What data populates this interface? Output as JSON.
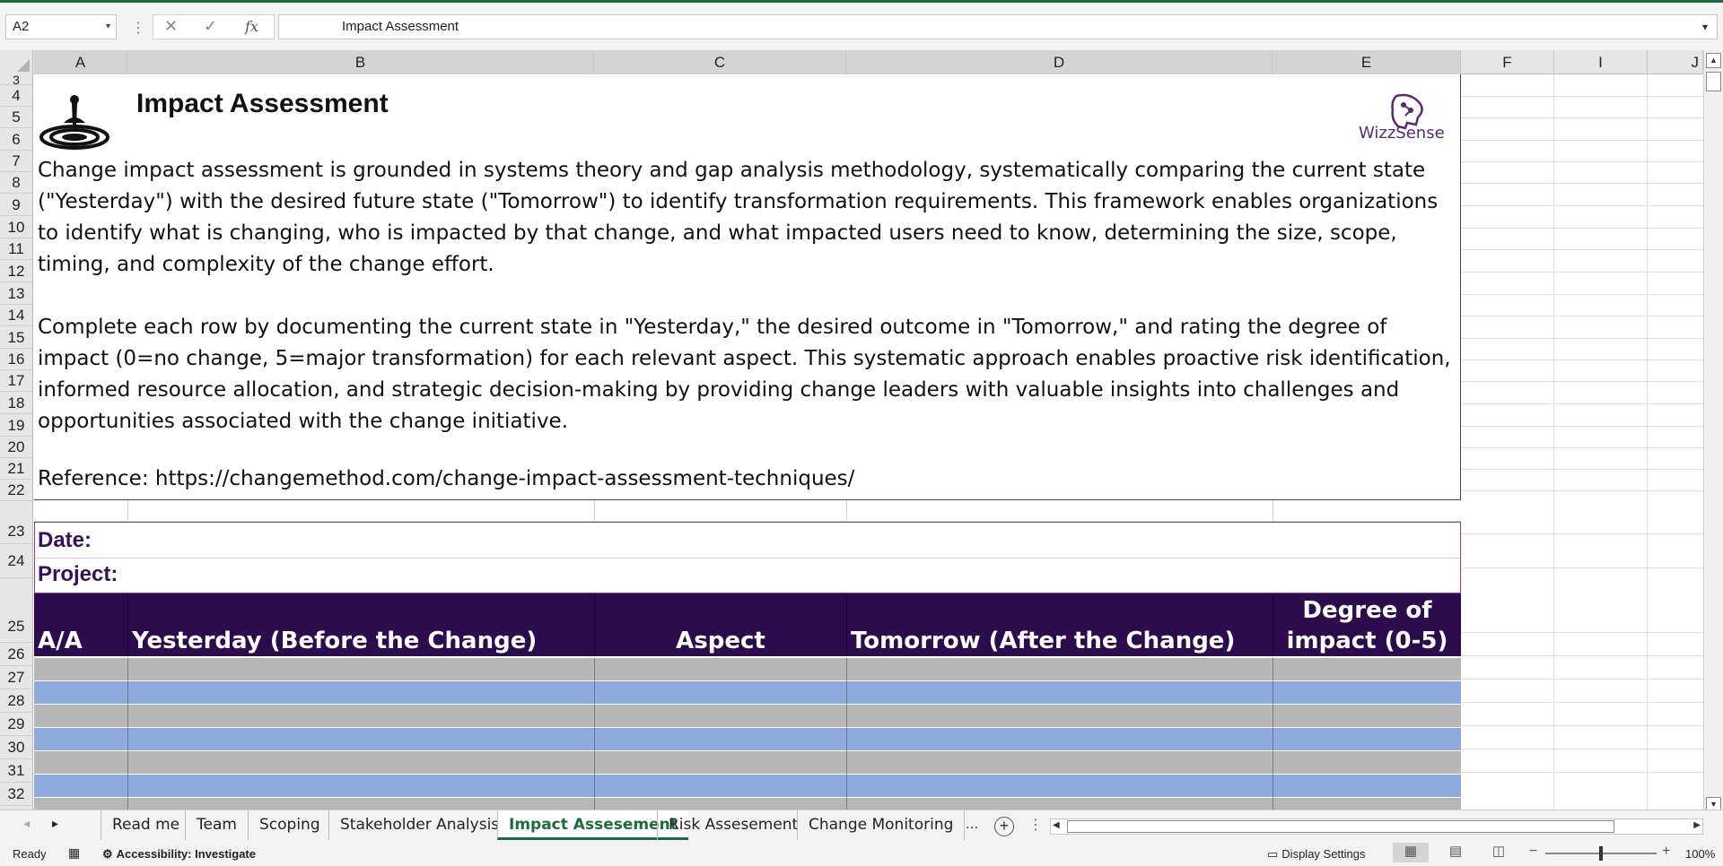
{
  "formula_bar": {
    "name_box": "A2",
    "formula": "Impact Assessment",
    "fx_label": "fx"
  },
  "columns": [
    "A",
    "B",
    "C",
    "D",
    "E",
    "F",
    "I",
    "J"
  ],
  "rows": [
    "3",
    "4",
    "5",
    "6",
    "7",
    "8",
    "9",
    "10",
    "11",
    "12",
    "13",
    "14",
    "15",
    "16",
    "17",
    "18",
    "19",
    "20",
    "21",
    "22",
    "23",
    "24",
    "25",
    "26",
    "27",
    "28",
    "29",
    "30",
    "31",
    "32"
  ],
  "sheet": {
    "title": "Impact Assessment",
    "logo_text": "WizzSense",
    "paragraph1": "Change impact assessment is grounded in systems theory and gap analysis methodology, systematically comparing the current state (\"Yesterday\") with the desired future state (\"Tomorrow\") to identify transformation requirements. This framework enables organizations to identify what is changing, who is impacted by that change, and what impacted users need to know, determining the size, scope, timing, and complexity of the change effort.",
    "paragraph2": "Complete each row by documenting the current state in \"Yesterday,\" the desired outcome in \"Tomorrow,\" and rating the degree of impact (0=no change, 5=major transformation) for each relevant aspect. This systematic approach enables proactive risk identification, informed resource allocation, and strategic decision-making by providing change leaders with valuable insights into challenges and opportunities associated with the change initiative.",
    "reference": "Reference: https://changemethod.com/change-impact-assessment-techniques/",
    "date_label": "Date:",
    "project_label": "Project:",
    "table_headers": {
      "aa": "A/A",
      "yesterday": "Yesterday (Before the Change)",
      "aspect": "Aspect",
      "tomorrow": "Tomorrow (After the Change)",
      "degree_line1": "Degree of",
      "degree_line2": "impact (0-5)"
    },
    "row_fill_colors": {
      "gray": "#b7b7b7",
      "blue": "#8ea9db",
      "header": "#2d0c4e"
    }
  },
  "tabs": {
    "items": [
      "Read me",
      "Team",
      "Scoping",
      "Stakeholder Analysis",
      "Impact Assesement",
      "Risk Assesement",
      "Change Monitoring"
    ],
    "active": "Impact Assesement",
    "more": "..."
  },
  "status_bar": {
    "ready": "Ready",
    "accessibility": "Accessibility: Investigate",
    "display_settings": "Display Settings",
    "zoom": "100%"
  }
}
